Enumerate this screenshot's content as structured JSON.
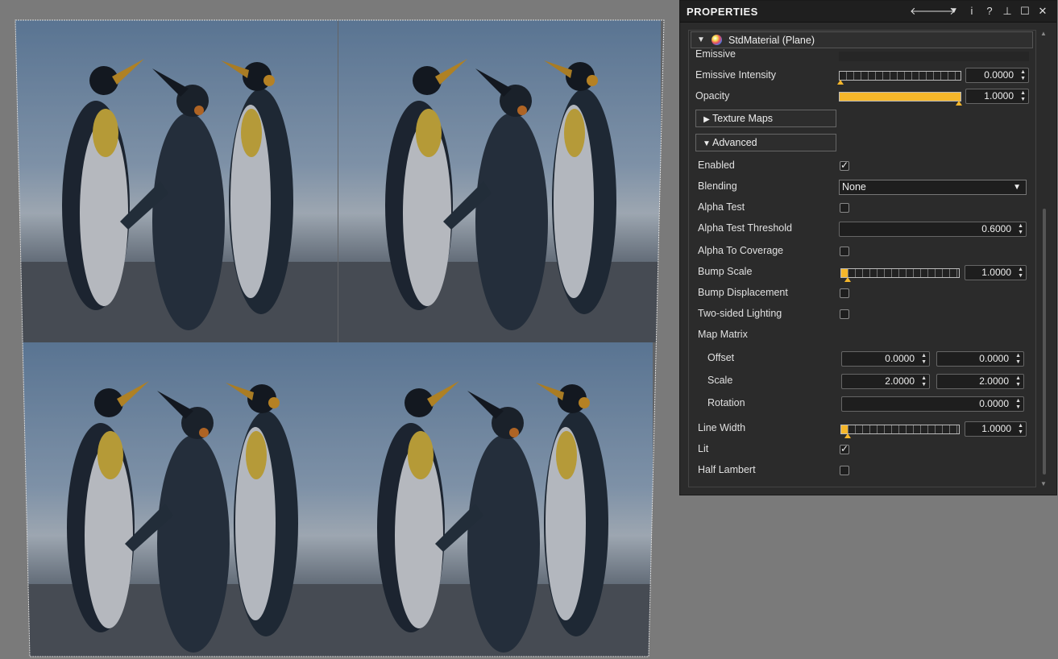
{
  "panel": {
    "title": "PROPERTIES",
    "icons": [
      "arrow-left-icon",
      "arrow-right-icon",
      "dropdown-icon",
      "info-icon",
      "help-icon",
      "pin-icon",
      "maximize-icon",
      "close-icon"
    ],
    "icon_glyphs": [
      "🡐",
      "🡒",
      "▼",
      "i",
      "?",
      "⊥",
      "☐",
      "✕"
    ]
  },
  "material": {
    "header": "StdMaterial (Plane)",
    "emissive_label": "Emissive",
    "emissive_intensity": {
      "label": "Emissive Intensity",
      "value": "0.0000",
      "fraction": 0.0
    },
    "opacity": {
      "label": "Opacity",
      "value": "1.0000",
      "fraction": 1.0
    },
    "texture_maps": "Texture Maps",
    "advanced": "Advanced",
    "enabled": {
      "label": "Enabled",
      "checked": true
    },
    "blending": {
      "label": "Blending",
      "value": "None"
    },
    "alpha_test": {
      "label": "Alpha Test",
      "checked": false
    },
    "alpha_test_threshold": {
      "label": "Alpha Test Threshold",
      "value": "0.6000"
    },
    "alpha_to_coverage": {
      "label": "Alpha To Coverage",
      "checked": false
    },
    "bump_scale": {
      "label": "Bump Scale",
      "value": "1.0000",
      "fraction": 0.02
    },
    "bump_displacement": {
      "label": "Bump Displacement",
      "checked": false
    },
    "two_sided_lighting": {
      "label": "Two-sided Lighting",
      "checked": false
    },
    "map_matrix": {
      "label": "Map Matrix",
      "offset": {
        "label": "Offset",
        "x": "0.0000",
        "y": "0.0000"
      },
      "scale": {
        "label": "Scale",
        "x": "2.0000",
        "y": "2.0000"
      },
      "rotation": {
        "label": "Rotation",
        "value": "0.0000"
      }
    },
    "line_width": {
      "label": "Line Width",
      "value": "1.0000",
      "fraction": 0.02
    },
    "lit": {
      "label": "Lit",
      "checked": true
    },
    "half_lambert": {
      "label": "Half Lambert",
      "checked": false
    }
  },
  "colors": {
    "accent": "#f5b62a",
    "panel_bg": "#2b2b2b",
    "viewport_bg": "#7a7a7a"
  }
}
